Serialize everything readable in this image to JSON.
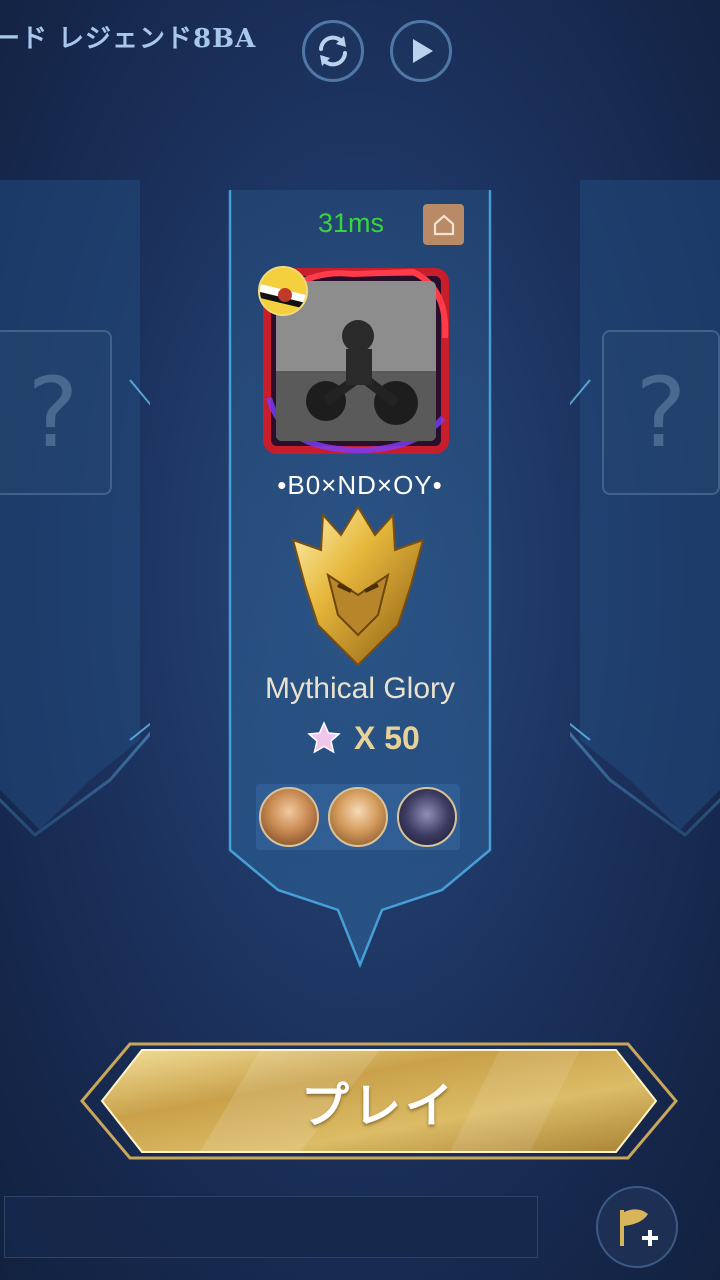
{
  "header": {
    "mode_title": "ード レジェンド8BA",
    "refresh_icon": "refresh-icon",
    "replay_icon": "play-icon"
  },
  "empty_slots": {
    "left_mark": "?",
    "right_mark": "?"
  },
  "player": {
    "ping": "31ms",
    "ping_color": "#39d33c",
    "home_icon": "home-icon",
    "name": "•B0×ND×OY•",
    "rank": "Mythical Glory",
    "stars_label": "X 50",
    "stars": 50
  },
  "play_button": {
    "label": "プレイ"
  },
  "footer": {
    "invite_icon": "flag-plus-icon"
  },
  "colors": {
    "accent_gold": "#d8b55a",
    "panel_blue": "#1d3461",
    "glow_blue": "#5fc2ff"
  }
}
